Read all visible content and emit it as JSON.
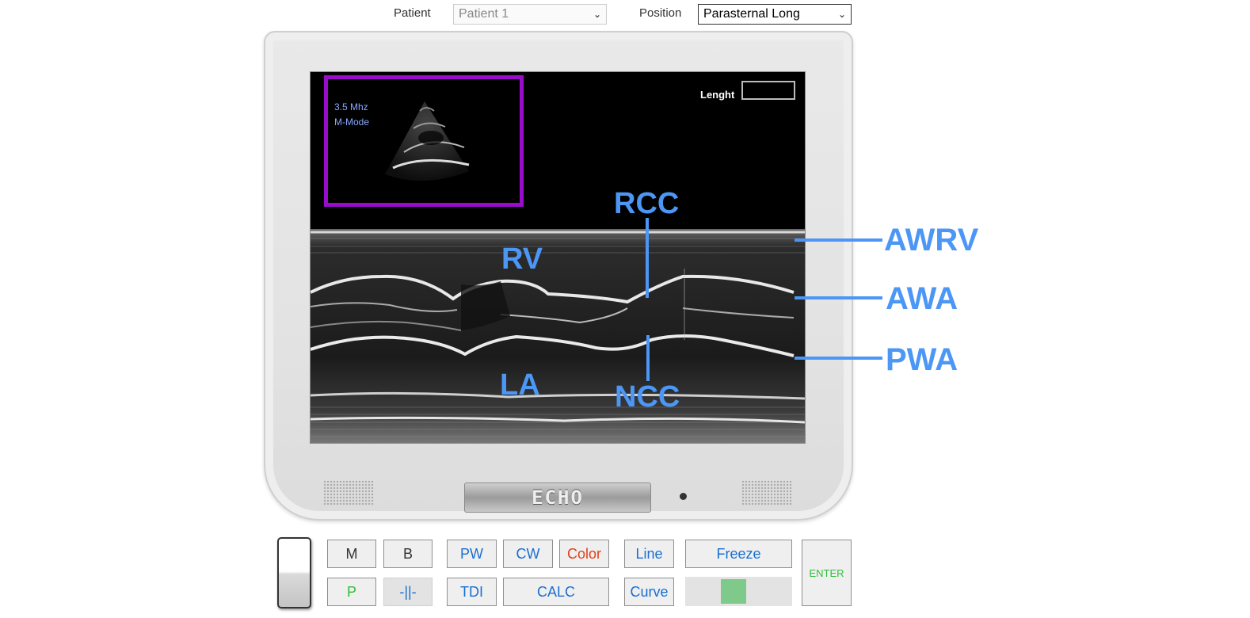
{
  "toolbar": {
    "patient_label": "Patient",
    "patient_value": "Patient 1",
    "position_label": "Position",
    "position_value": "Parasternal Long"
  },
  "screen": {
    "frequency": "3.5 Mhz",
    "mode": "M-Mode",
    "length_label": "Lenght",
    "length_value": ""
  },
  "annotations": {
    "rcc": "RCC",
    "rv": "RV",
    "la": "LA",
    "ncc": "NCC",
    "awrv": "AWRV",
    "awa": "AWA",
    "pwa": "PWA"
  },
  "device": {
    "brand": "ECHO"
  },
  "controls": {
    "m": "M",
    "b": "B",
    "pw": "PW",
    "cw": "CW",
    "color": "Color",
    "line": "Line",
    "freeze": "Freeze",
    "enter": "ENTER",
    "p": "P",
    "separator": "-||-",
    "tdi": "TDI",
    "calc": "CALC",
    "curve": "Curve"
  },
  "colors": {
    "annotation": "#4c97f5",
    "preview_frame": "#9a0ccc",
    "color_button": "#e0401a",
    "p_button": "#2fbf3a",
    "enter_button": "#2fbf3a",
    "slider_thumb": "#7fc98a"
  },
  "slider": {
    "level": 0.44
  }
}
